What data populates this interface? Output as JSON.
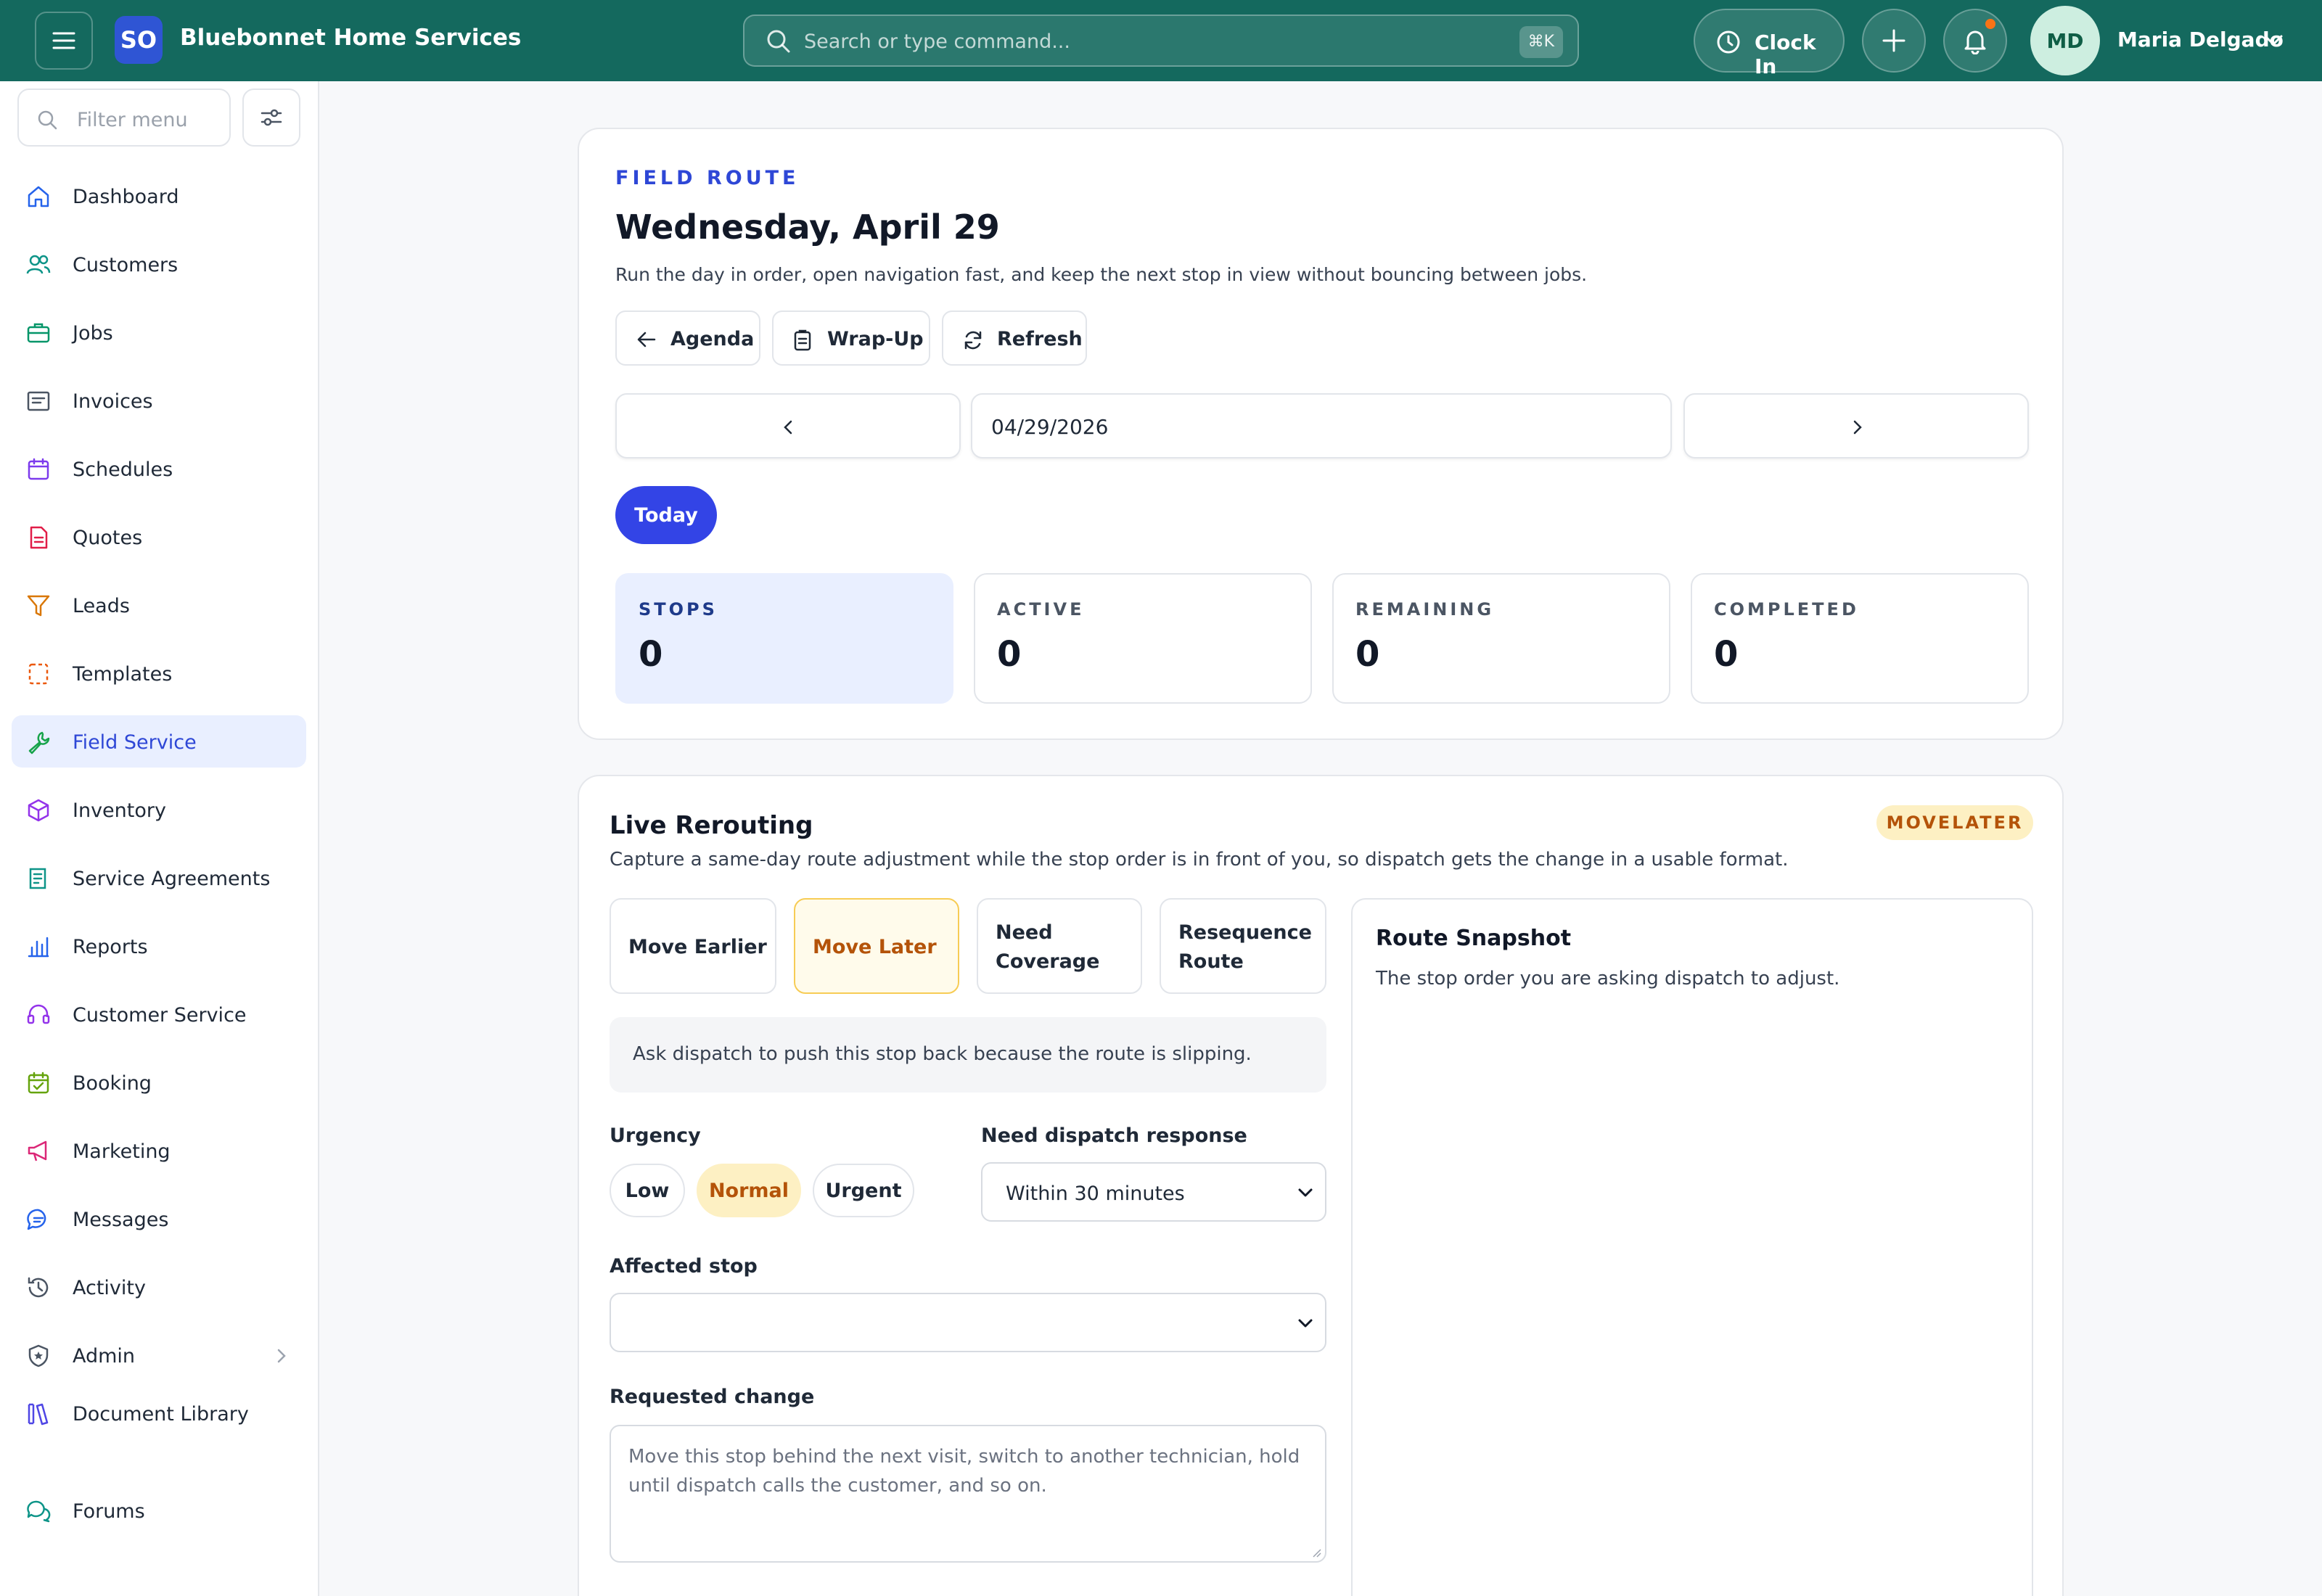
{
  "app": {
    "logo_text": "SO",
    "brand": "Bluebonnet Home Services"
  },
  "search": {
    "placeholder": "Search or type command...",
    "shortcut": "⌘K"
  },
  "header": {
    "clock_in_label": "Clock In",
    "user_initials": "MD",
    "user_name": "Maria Delgado"
  },
  "sidebar": {
    "filter_placeholder": "Filter menu",
    "items": [
      {
        "label": "Dashboard",
        "icon": "home-icon"
      },
      {
        "label": "Customers",
        "icon": "users-icon"
      },
      {
        "label": "Jobs",
        "icon": "briefcase-icon"
      },
      {
        "label": "Invoices",
        "icon": "invoice-icon"
      },
      {
        "label": "Schedules",
        "icon": "calendar-icon"
      },
      {
        "label": "Quotes",
        "icon": "document-icon"
      },
      {
        "label": "Leads",
        "icon": "funnel-icon"
      },
      {
        "label": "Templates",
        "icon": "template-icon"
      },
      {
        "label": "Field Service",
        "icon": "wrench-icon",
        "active": true
      },
      {
        "label": "Inventory",
        "icon": "box-icon"
      },
      {
        "label": "Service Agreements",
        "icon": "agreement-icon"
      },
      {
        "label": "Reports",
        "icon": "bar-chart-icon"
      },
      {
        "label": "Customer Service",
        "icon": "headset-icon"
      },
      {
        "label": "Booking",
        "icon": "calendar-check-icon"
      },
      {
        "label": "Marketing",
        "icon": "megaphone-icon"
      },
      {
        "label": "Messages",
        "icon": "chat-icon"
      },
      {
        "label": "Activity",
        "icon": "history-icon"
      },
      {
        "label": "Admin",
        "icon": "shield-icon"
      },
      {
        "label": "Document Library",
        "icon": "library-icon"
      },
      {
        "label": "Forums",
        "icon": "forum-icon"
      }
    ]
  },
  "route": {
    "eyebrow": "FIELD ROUTE",
    "title": "Wednesday, April 29",
    "description": "Run the day in order, open navigation fast, and keep the next stop in view without bouncing between jobs.",
    "actions": {
      "agenda": "Agenda",
      "wrapup": "Wrap-Up",
      "refresh": "Refresh"
    },
    "date_value": "04/29/2026",
    "today_label": "Today",
    "stats": [
      {
        "label": "STOPS",
        "value": "0"
      },
      {
        "label": "ACTIVE",
        "value": "0"
      },
      {
        "label": "REMAINING",
        "value": "0"
      },
      {
        "label": "COMPLETED",
        "value": "0"
      }
    ]
  },
  "rerouting": {
    "title": "Live Rerouting",
    "badge": "MOVELATER",
    "description": "Capture a same-day route adjustment while the stop order is in front of you, so dispatch gets the change in a usable format.",
    "options": [
      {
        "label": "Move Earlier"
      },
      {
        "label": "Move Later",
        "selected": true
      },
      {
        "label": "Need Coverage"
      },
      {
        "label": "Resequence Route"
      }
    ],
    "hint": "Ask dispatch to push this stop back because the route is slipping.",
    "urgency_label": "Urgency",
    "urgency_options": [
      "Low",
      "Normal",
      "Urgent"
    ],
    "urgency_selected": "Normal",
    "response_label": "Need dispatch response",
    "response_value": "Within 30 minutes",
    "affected_stop_label": "Affected stop",
    "affected_stop_value": "",
    "requested_change_label": "Requested change",
    "requested_change_placeholder": "Move this stop behind the next visit, switch to another technician, hold until dispatch calls the customer, and so on.",
    "snapshot_title": "Route Snapshot",
    "snapshot_desc": "The stop order you are asking dispatch to adjust."
  },
  "colors": {
    "topbar": "#14695e",
    "primary": "#3344e6",
    "accent_amber": "#b45309"
  }
}
